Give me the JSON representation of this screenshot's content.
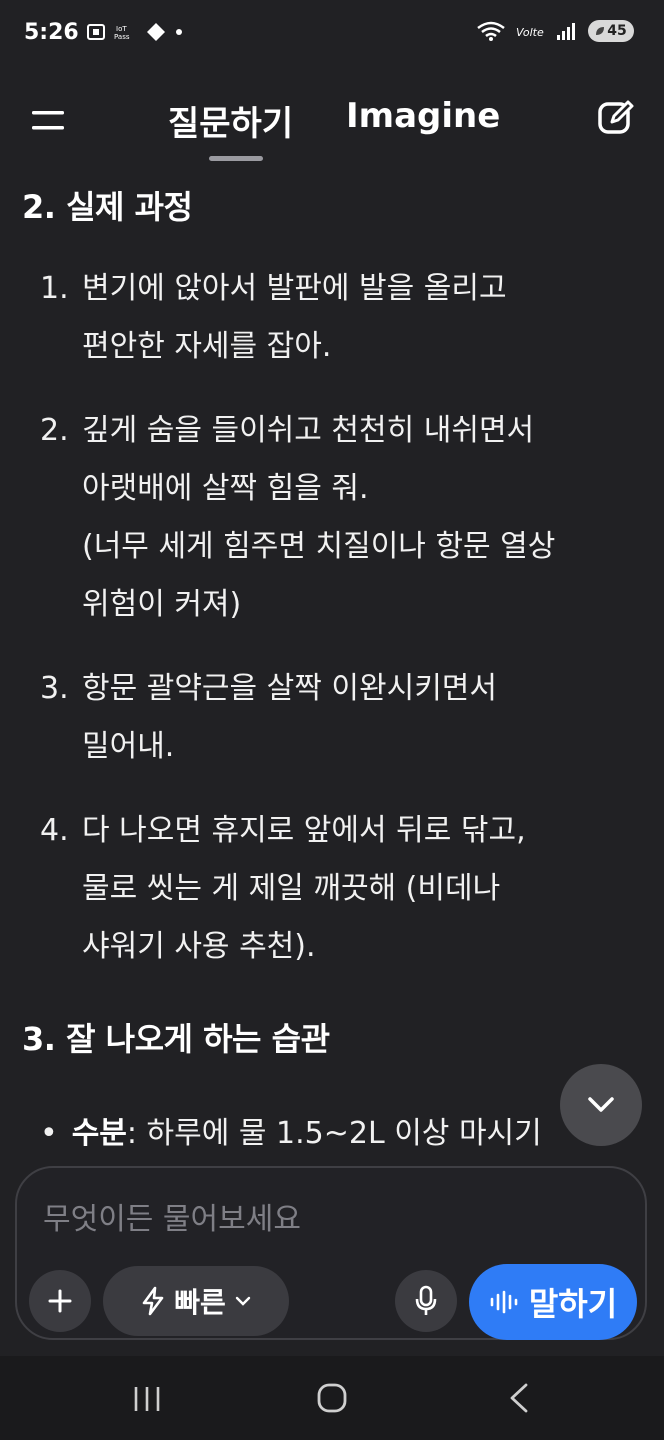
{
  "status": {
    "time": "5:26",
    "battery": "45",
    "network": "Vo LTE",
    "signal": "5"
  },
  "header": {
    "tab_ask": "질문하기",
    "tab_imagine": "Imagine"
  },
  "content": {
    "section2_title": "2. 실제 과정",
    "steps": [
      {
        "num": "1.",
        "lines": [
          "변기에 앉아서 발판에 발을 올리고",
          "편안한 자세를 잡아."
        ]
      },
      {
        "num": "2.",
        "lines": [
          "깊게 숨을 들이쉬고 천천히 내쉬면서",
          "아랫배에 살짝 힘을 줘.",
          "(너무 세게 힘주면 치질이나 항문 열상",
          "위험이 커져)"
        ]
      },
      {
        "num": "3.",
        "lines": [
          "항문 괄약근을 살짝 이완시키면서",
          "밀어내."
        ]
      },
      {
        "num": "4.",
        "lines": [
          "다 나오면 휴지로 앞에서 뒤로 닦고,",
          "물로 씻는 게 제일 깨끗해 (비데나",
          "샤워기 사용 추천)."
        ]
      }
    ],
    "section3_title": "3. 잘 나오게 하는 습관",
    "bullet1_bold": "수분",
    "bullet1_text": ": 하루에 물 1.5~2L 이상 마시기"
  },
  "composer": {
    "placeholder": "무엇이든 물어보세요",
    "mode_label": "빠른",
    "speak_label": "말하기"
  },
  "colors": {
    "background": "#212124",
    "accent": "#2f7cf6"
  }
}
